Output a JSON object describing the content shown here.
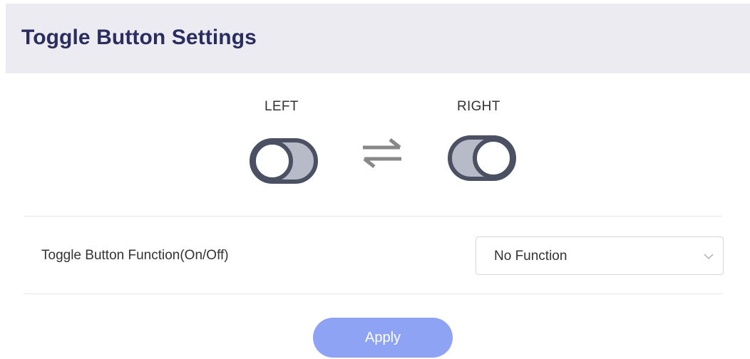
{
  "header": {
    "title": "Toggle Button Settings"
  },
  "toggles": {
    "left_label": "LEFT",
    "right_label": "RIGHT",
    "left_icon": "toggle-off-icon",
    "right_icon": "toggle-on-icon",
    "swap_icon": "swap-arrows-icon"
  },
  "function": {
    "label": "Toggle Button Function(On/Off)",
    "selected": "No Function"
  },
  "actions": {
    "apply_label": "Apply"
  },
  "colors": {
    "header_bg": "#ecebf2",
    "title": "#2b2d5e",
    "toggle_outline": "#4b5063",
    "toggle_fill": "#b7bbc7",
    "apply_bg": "#8fa3f5"
  }
}
